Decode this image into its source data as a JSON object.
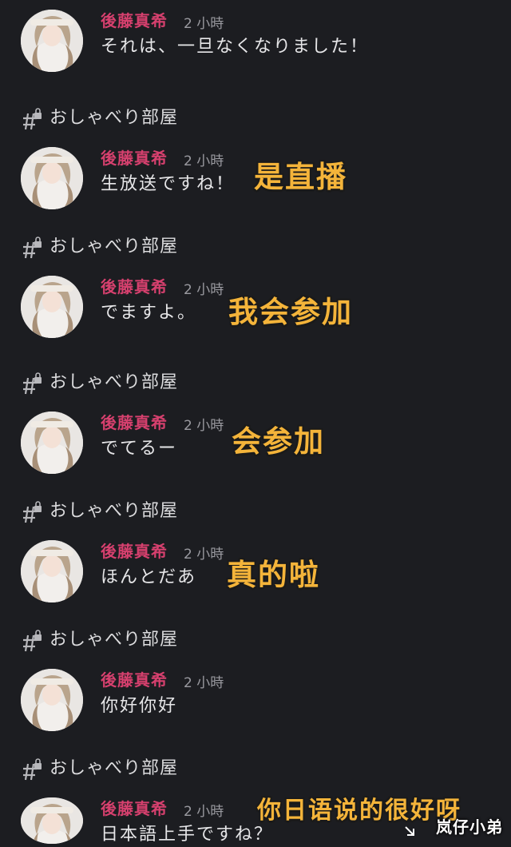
{
  "messages": [
    {
      "user": "後藤真希",
      "time": "2 小時",
      "text": "それは、一旦なくなりました！",
      "caption": ""
    },
    {
      "user": "後藤真希",
      "time": "2 小時",
      "text": "生放送ですね！",
      "caption": "是直播"
    },
    {
      "user": "後藤真希",
      "time": "2 小時",
      "text": "でますよ。",
      "caption": "我会参加"
    },
    {
      "user": "後藤真希",
      "time": "2 小時",
      "text": "でてるー",
      "caption": "会参加"
    },
    {
      "user": "後藤真希",
      "time": "2 小時",
      "text": "ほんとだあ",
      "caption": "真的啦"
    },
    {
      "user": "後藤真希",
      "time": "2 小時",
      "text": "你好你好",
      "caption": ""
    },
    {
      "user": "後藤真希",
      "time": "2 小時",
      "text": "日本語上手ですね？",
      "caption": "你日语说的很好呀"
    }
  ],
  "channel_name": "おしゃべり部屋",
  "watermark": "岚仔小弟",
  "colors": {
    "background": "#1c1d21",
    "username": "#d6406e",
    "timestamp": "#9a9aa0",
    "caption": "#f4b43a"
  }
}
